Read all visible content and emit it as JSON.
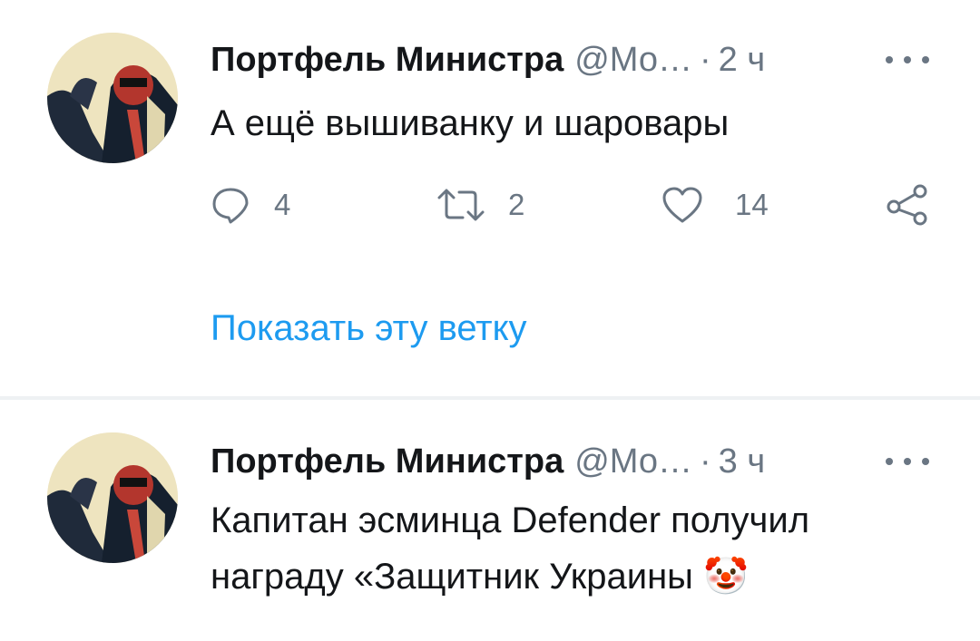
{
  "tweets": [
    {
      "author": "Портфель Министра",
      "handle": "@Мо…",
      "separator": "·",
      "time": "2 ч",
      "text_lines": [
        "А ещё вышиванку и шаровары"
      ],
      "actions": {
        "replies": "4",
        "retweets": "2",
        "likes": "14"
      }
    },
    {
      "author": "Портфель Министра",
      "handle": "@Мо…",
      "separator": "·",
      "time": "3 ч",
      "text_lines": [
        "Капитан эсминца Defender получил",
        "награду «Защитник Украины 🤡"
      ]
    }
  ],
  "show_thread": "Показать эту ветку",
  "icons": {
    "reply": "speech-bubble-icon",
    "retweet": "retweet-arrows-icon",
    "like": "heart-icon",
    "share": "share-nodes-icon",
    "more": "ellipsis-icon"
  },
  "colors": {
    "text": "#141619",
    "secondary": "#6a7683",
    "link": "#1d9bf0",
    "divider": "#eef1f3"
  }
}
